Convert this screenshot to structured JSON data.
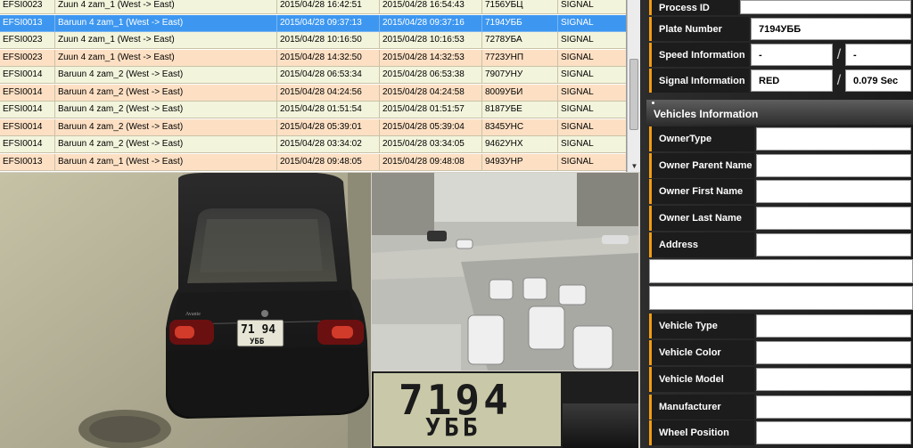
{
  "table": {
    "rows": [
      {
        "id": "EFSI0023",
        "location": "Zuun 4 zam_1 (West -> East)",
        "t1": "2015/04/28 16:42:51",
        "t2": "2015/04/28 16:54:43",
        "plate": "7156УБЦ",
        "type": "SIGNAL",
        "selected": false
      },
      {
        "id": "EFSI0013",
        "location": "Baruun 4 zam_1 (West -> East)",
        "t1": "2015/04/28 09:37:13",
        "t2": "2015/04/28 09:37:16",
        "plate": "7194УББ",
        "type": "SIGNAL",
        "selected": true
      },
      {
        "id": "EFSI0023",
        "location": "Zuun 4 zam_1 (West -> East)",
        "t1": "2015/04/28 10:16:50",
        "t2": "2015/04/28 10:16:53",
        "plate": "7278УБА",
        "type": "SIGNAL",
        "selected": false
      },
      {
        "id": "EFSI0023",
        "location": "Zuun 4 zam_1 (West -> East)",
        "t1": "2015/04/28 14:32:50",
        "t2": "2015/04/28 14:32:53",
        "plate": "7723УНП",
        "type": "SIGNAL",
        "selected": false
      },
      {
        "id": "EFSI0014",
        "location": "Baruun 4 zam_2 (West -> East)",
        "t1": "2015/04/28 06:53:34",
        "t2": "2015/04/28 06:53:38",
        "plate": "7907УНУ",
        "type": "SIGNAL",
        "selected": false
      },
      {
        "id": "EFSI0014",
        "location": "Baruun 4 zam_2 (West -> East)",
        "t1": "2015/04/28 04:24:56",
        "t2": "2015/04/28 04:24:58",
        "plate": "8009УБИ",
        "type": "SIGNAL",
        "selected": false
      },
      {
        "id": "EFSI0014",
        "location": "Baruun 4 zam_2 (West -> East)",
        "t1": "2015/04/28 01:51:54",
        "t2": "2015/04/28 01:51:57",
        "plate": "8187УБЕ",
        "type": "SIGNAL",
        "selected": false
      },
      {
        "id": "EFSI0014",
        "location": "Baruun 4 zam_2 (West -> East)",
        "t1": "2015/04/28 05:39:01",
        "t2": "2015/04/28 05:39:04",
        "plate": "8345УНС",
        "type": "SIGNAL",
        "selected": false
      },
      {
        "id": "EFSI0014",
        "location": "Baruun 4 zam_2 (West -> East)",
        "t1": "2015/04/28 03:34:02",
        "t2": "2015/04/28 03:34:05",
        "plate": "9462УНХ",
        "type": "SIGNAL",
        "selected": false
      },
      {
        "id": "EFSI0013",
        "location": "Baruun 4 zam_1 (West -> East)",
        "t1": "2015/04/28 09:48:05",
        "t2": "2015/04/28 09:48:08",
        "plate": "9493УНР",
        "type": "SIGNAL",
        "selected": false
      }
    ]
  },
  "plate_image": {
    "line1": "7194",
    "line2": "УББ"
  },
  "car_plate": {
    "line1": "71 94",
    "line2": "УББ"
  },
  "car_badge": "Avante",
  "violation": {
    "process_id_label": "Process ID",
    "process_id_value": "",
    "plate_number_label": "Plate Number",
    "plate_number_value": "7194УББ",
    "speed_label": "Speed Information",
    "speed_value1": "-",
    "speed_value2": "-",
    "signal_label": "Signal Information",
    "signal_value1": "RED",
    "signal_value2": "0.079 Sec",
    "separator": "/"
  },
  "vehicles": {
    "header": "Vehicles Information",
    "owner_type_label": "OwnerType",
    "owner_parent_name_label": "Owner Parent Name",
    "owner_first_name_label": "Owner First Name",
    "owner_last_name_label": "Owner Last Name",
    "address_label": "Address",
    "vehicle_type_label": "Vehicle Type",
    "vehicle_color_label": "Vehicle Color",
    "vehicle_model_label": "Vehicle Model",
    "manufacturer_label": "Manufacturer",
    "wheel_position_label": "Wheel Position"
  },
  "colors": {
    "accent": "#f39c12",
    "selected_row": "#3d97f0",
    "odd_row": "#f3f4dc",
    "even_row": "#fde0c4",
    "panel": "#1c1c1c"
  }
}
